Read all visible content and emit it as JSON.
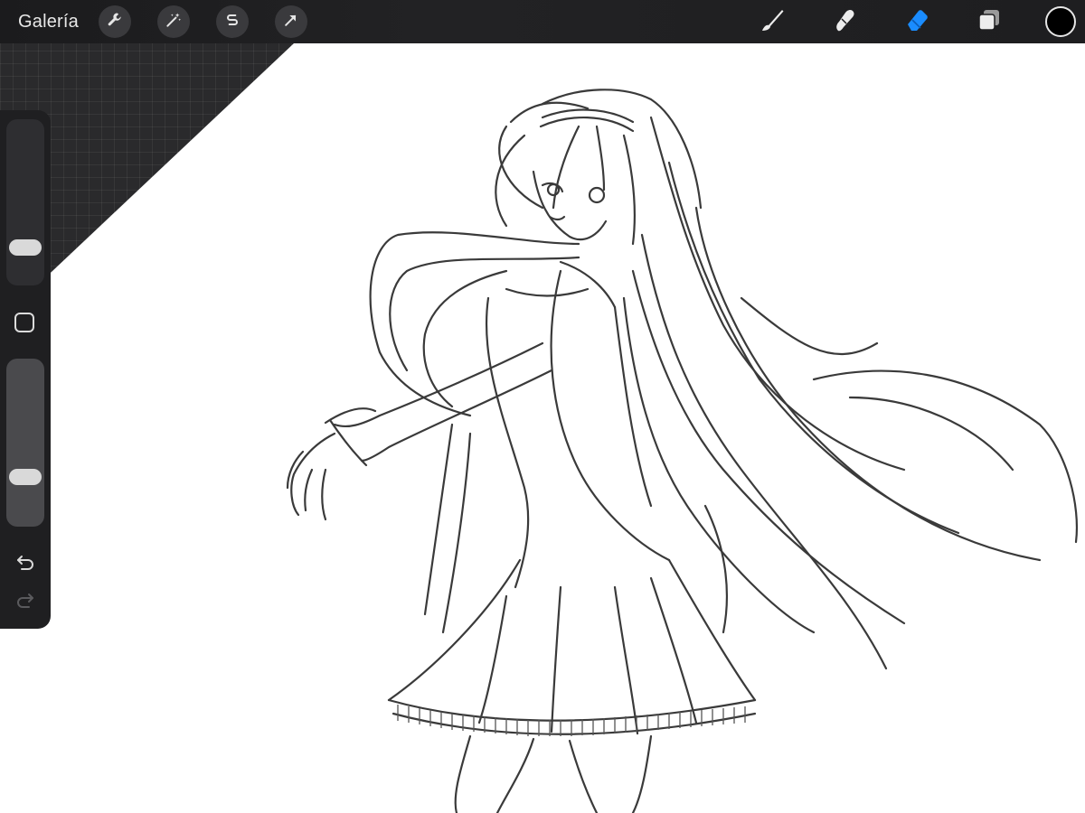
{
  "app": {
    "gallery_label": "Galería"
  },
  "toolbar": {
    "left_icons": [
      "wrench-icon",
      "magic-wand-icon",
      "selection-s-icon",
      "arrow-transform-icon"
    ],
    "right_tools": [
      "brush-icon",
      "smudge-icon",
      "eraser-icon",
      "layers-icon"
    ],
    "active_tool": "eraser-icon",
    "active_tool_color": "#1a8cff",
    "current_color": "#000000"
  },
  "sidebar": {
    "controls": [
      "brush-size-slider",
      "modify-button",
      "opacity-slider",
      "undo-icon",
      "redo-icon"
    ]
  }
}
